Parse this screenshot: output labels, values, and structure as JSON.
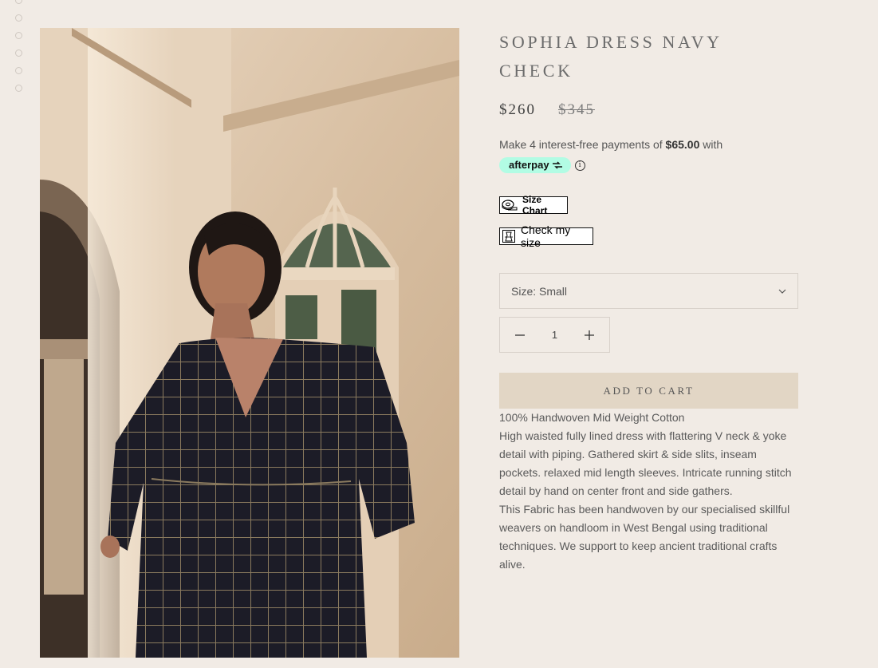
{
  "product": {
    "title": "SOPHIA DRESS NAVY CHECK",
    "price": "$260",
    "compare_price": "$345",
    "afterpay": {
      "prefix": "Make 4 interest-free payments of ",
      "amount": "$65.00",
      "suffix": " with",
      "badge_label": "afterpay",
      "badge_color": "#b2fce4"
    },
    "size_chart_label": "Size Chart",
    "check_size_label": "Check my size",
    "size_select_label": "Size: Small",
    "quantity": "1",
    "add_to_cart_label": "ADD TO CART",
    "description": [
      "100% Handwoven Mid Weight Cotton",
      "High waisted fully lined dress with flattering V neck & yoke detail with piping.  Gathered skirt & side slits, inseam pockets. relaxed mid length sleeves. Intricate running stitch detail by hand on center front and side gathers.",
      "This Fabric has been handwoven by our specialised skillful weavers on handloom in West Bengal using traditional techniques.  We support to keep ancient traditional crafts alive."
    ]
  },
  "gallery": {
    "thumbnail_count": 6
  },
  "icons": {
    "info": "info-icon",
    "chevron": "chevron-down-icon",
    "minus": "minus-icon",
    "plus": "plus-icon",
    "tape": "measuring-tape-icon",
    "hanger": "dress-hanger-icon"
  },
  "colors": {
    "background": "#f1ebe5",
    "button": "#e2d6c5",
    "dress": "#1f1f2b"
  }
}
